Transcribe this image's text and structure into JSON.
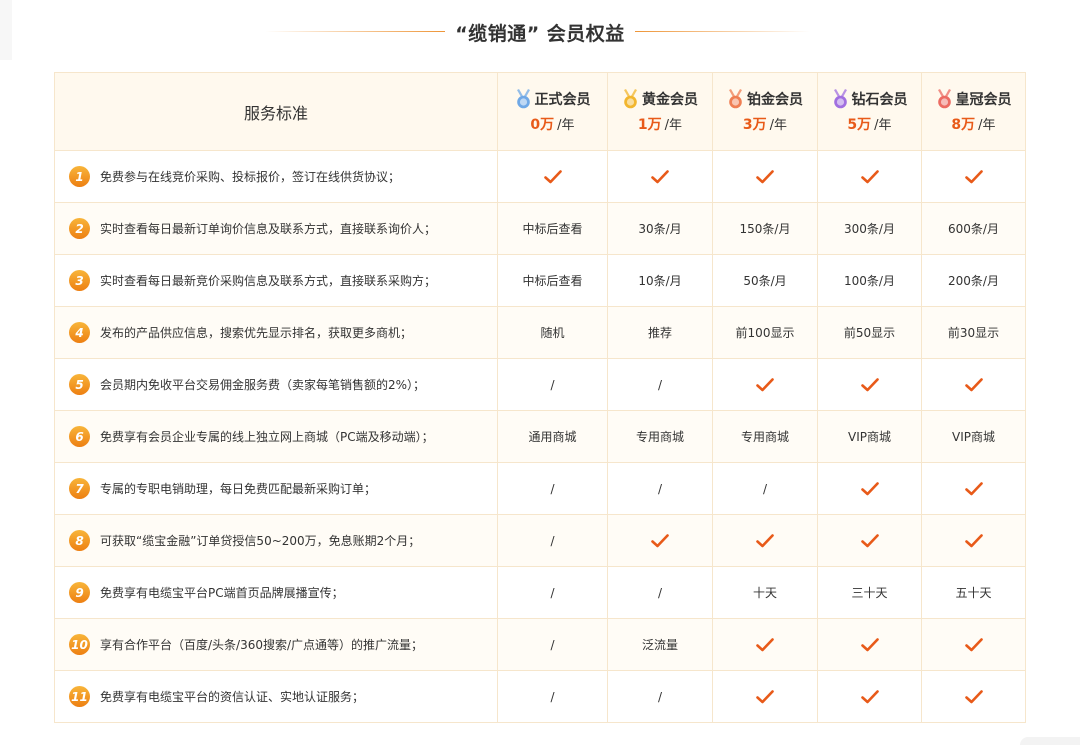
{
  "header": {
    "title": "“缆销通” 会员权益"
  },
  "table": {
    "service_header": "服务标准",
    "tiers": [
      {
        "name": "正式会员",
        "amount": "0万",
        "unit": "/年",
        "medal": "blue-medal-icon",
        "color": "#6fa8e6"
      },
      {
        "name": "黄金会员",
        "amount": "1万",
        "unit": "/年",
        "medal": "gold-medal-icon",
        "color": "#f2b62e"
      },
      {
        "name": "铂金会员",
        "amount": "3万",
        "unit": "/年",
        "medal": "platinum-medal-icon",
        "color": "#ef7e53"
      },
      {
        "name": "钻石会员",
        "amount": "5万",
        "unit": "/年",
        "medal": "diamond-medal-icon",
        "color": "#a16fe0"
      },
      {
        "name": "皇冠会员",
        "amount": "8万",
        "unit": "/年",
        "medal": "crown-medal-icon",
        "color": "#ec6b62"
      }
    ],
    "rows": [
      {
        "num": "1",
        "text": "免费参与在线竞价采购、投标报价，签订在线供货协议；",
        "values": [
          "✓",
          "✓",
          "✓",
          "✓",
          "✓"
        ]
      },
      {
        "num": "2",
        "text": "实时查看每日最新订单询价信息及联系方式，直接联系询价人；",
        "values": [
          "中标后查看",
          "30条/月",
          "150条/月",
          "300条/月",
          "600条/月"
        ]
      },
      {
        "num": "3",
        "text": "实时查看每日最新竞价采购信息及联系方式，直接联系采购方；",
        "values": [
          "中标后查看",
          "10条/月",
          "50条/月",
          "100条/月",
          "200条/月"
        ]
      },
      {
        "num": "4",
        "text": "发布的产品供应信息，搜索优先显示排名，获取更多商机；",
        "values": [
          "随机",
          "推荐",
          "前100显示",
          "前50显示",
          "前30显示"
        ]
      },
      {
        "num": "5",
        "text": "会员期内免收平台交易佣金服务费（卖家每笔销售额的2%）；",
        "values": [
          "/",
          "/",
          "✓",
          "✓",
          "✓"
        ]
      },
      {
        "num": "6",
        "text": "免费享有会员企业专属的线上独立网上商城（PC端及移动端）；",
        "values": [
          "通用商城",
          "专用商城",
          "专用商城",
          "VIP商城",
          "VIP商城"
        ]
      },
      {
        "num": "7",
        "text": "专属的专职电销助理，每日免费匹配最新采购订单；",
        "values": [
          "/",
          "/",
          "/",
          "✓",
          "✓"
        ]
      },
      {
        "num": "8",
        "text": "可获取“缆宝金融”订单贷授信50~200万，免息账期2个月；",
        "values": [
          "/",
          "✓",
          "✓",
          "✓",
          "✓"
        ]
      },
      {
        "num": "9",
        "text": "免费享有电缆宝平台PC端首页品牌展播宣传；",
        "values": [
          "/",
          "/",
          "十天",
          "三十天",
          "五十天"
        ]
      },
      {
        "num": "10",
        "text": "享有合作平台（百度/头条/360搜索/广点通等）的推广流量；",
        "values": [
          "/",
          "泛流量",
          "✓",
          "✓",
          "✓"
        ]
      },
      {
        "num": "11",
        "text": "免费享有电缆宝平台的资信认证、实地认证服务；",
        "values": [
          "/",
          "/",
          "✓",
          "✓",
          "✓"
        ]
      }
    ]
  },
  "colors": {
    "accent": "#e85a19",
    "number_badge": "#f19a22",
    "border": "#f6e6cc",
    "header_bg": "#fff9ee"
  }
}
